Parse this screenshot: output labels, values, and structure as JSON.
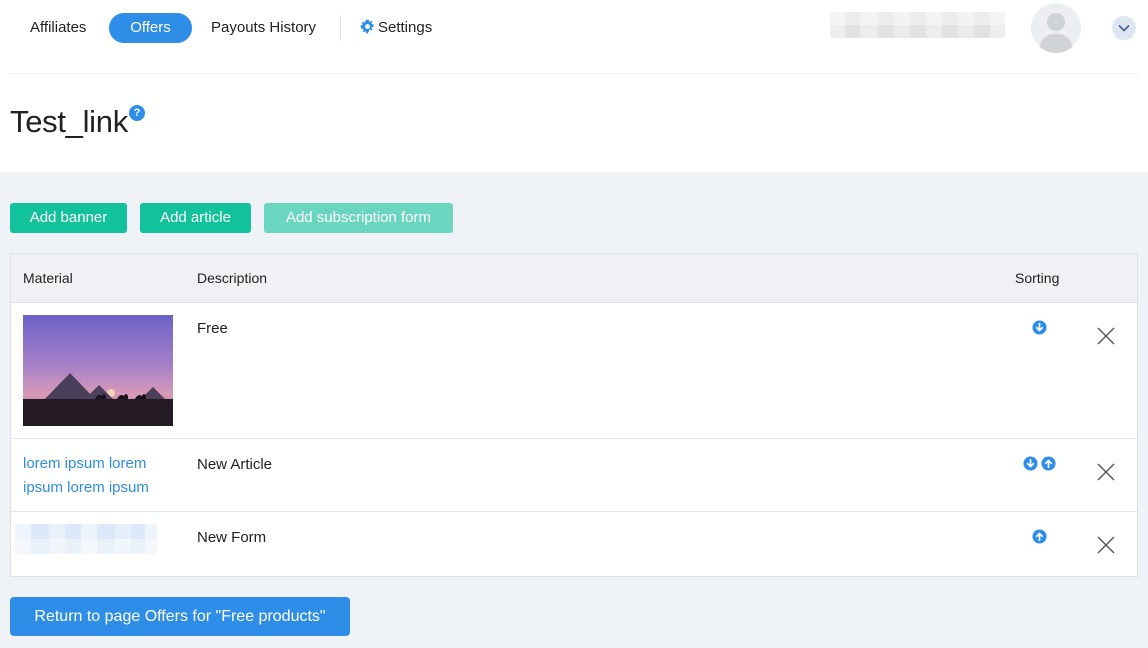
{
  "nav": {
    "items": [
      {
        "label": "Affiliates",
        "active": false
      },
      {
        "label": "Offers",
        "active": true
      },
      {
        "label": "Payouts History",
        "active": false
      }
    ],
    "settings_label": "Settings",
    "settings_icon": "gear-icon",
    "user_icon": "user-silhouette-icon",
    "menu_icon": "chevron-down-icon",
    "accent_color": "#2e8de6"
  },
  "page": {
    "title": "Test_link",
    "help_glyph": "?"
  },
  "actions": {
    "add_banner": "Add banner",
    "add_article": "Add article",
    "add_subscription_form": "Add subscription form",
    "green_color": "#12c29a",
    "green_light_color": "#6bd6c0"
  },
  "table": {
    "columns": [
      "Material",
      "Description",
      "Sorting"
    ],
    "rows": [
      {
        "material_type": "banner-image",
        "description": "Free",
        "sorting": [
          "move-down"
        ]
      },
      {
        "material_type": "article-link",
        "material_lines": [
          "lorem ipsum lorem",
          "ipsum lorem ipsum"
        ],
        "description": "New Article",
        "sorting": [
          "move-down",
          "move-up"
        ]
      },
      {
        "material_type": "subscription-form",
        "description": "New Form",
        "sorting": [
          "move-up"
        ]
      }
    ]
  },
  "footer": {
    "return_label": "Return to page Offers for \"Free products\""
  }
}
